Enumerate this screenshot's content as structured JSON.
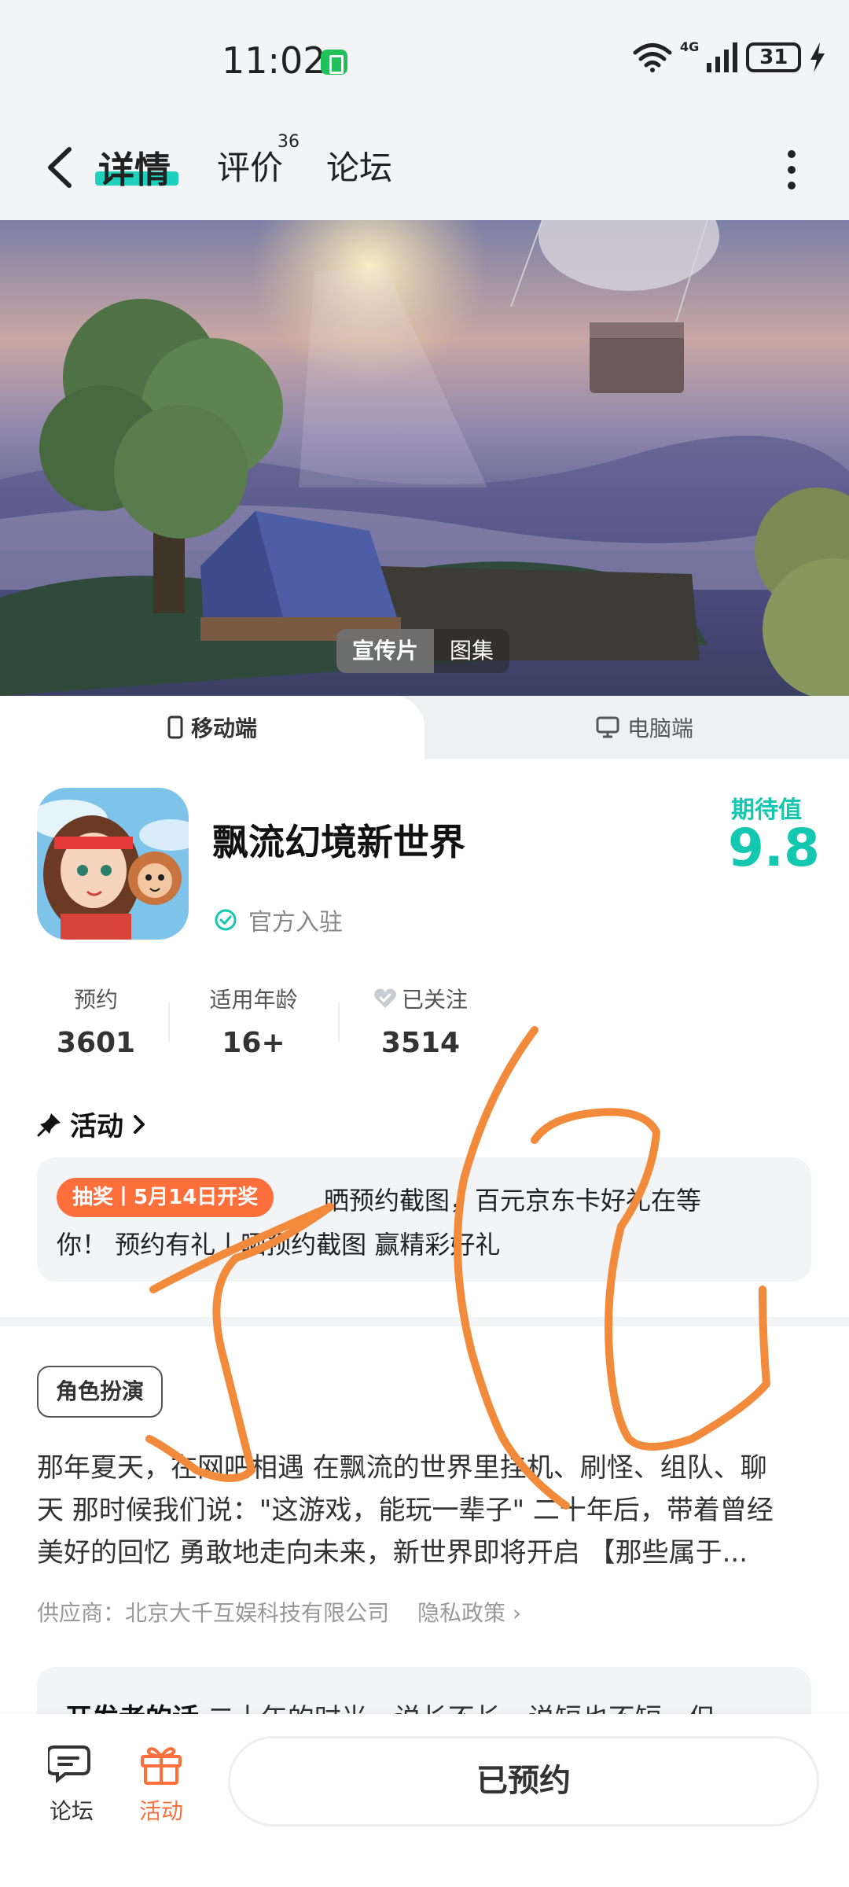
{
  "status_bar": {
    "time": "11:02",
    "network": "4G",
    "battery": "31"
  },
  "header": {
    "tabs": [
      {
        "label": "详情",
        "active": true
      },
      {
        "label": "评价",
        "badge": "36"
      },
      {
        "label": "论坛"
      }
    ]
  },
  "banner": {
    "media_tabs": [
      {
        "label": "宣传片",
        "active": true
      },
      {
        "label": "图集"
      }
    ]
  },
  "platform": {
    "mobile": "移动端",
    "pc": "电脑端"
  },
  "game": {
    "title": "飘流幻境新世界",
    "official": "官方入驻",
    "expect_label": "期待值",
    "expect_value": "9.8"
  },
  "stats": [
    {
      "label": "预约",
      "value": "3601"
    },
    {
      "label": "适用年龄",
      "value": "16+"
    },
    {
      "label": "已关注",
      "value": "3514"
    }
  ],
  "activity": {
    "heading": "活动",
    "badge": "抽奖丨5月14日开奖",
    "line1": "晒预约截图，百元京东卡好礼在等",
    "line2": "你！ 预约有礼丨晒预约截图 赢精彩好礼"
  },
  "genre_tag": "角色扮演",
  "description": {
    "line1": "那年夏天，在网吧相遇 在飘流的世界里挂机、刷怪、组队、聊",
    "line2": "天 那时候我们说：\"这游戏，能玩一辈子\" 二十年后，带着曾经",
    "line3": "美好的回忆 勇敢地走向未来，新世界即将开启 【那些属于..."
  },
  "supplier": {
    "label": "供应商：北京大千互娱科技有限公司",
    "privacy": "隐私政策"
  },
  "developer": {
    "heading": "开发者的话",
    "text": "二十年的时光，说长不长，说短也不短，但"
  },
  "bottom_nav": {
    "forum": "论坛",
    "activity": "活动",
    "reserve": "已预约"
  },
  "colors": {
    "accent": "#13c7b0",
    "orange": "#ff6f3c",
    "scribble": "#f28a3c"
  }
}
